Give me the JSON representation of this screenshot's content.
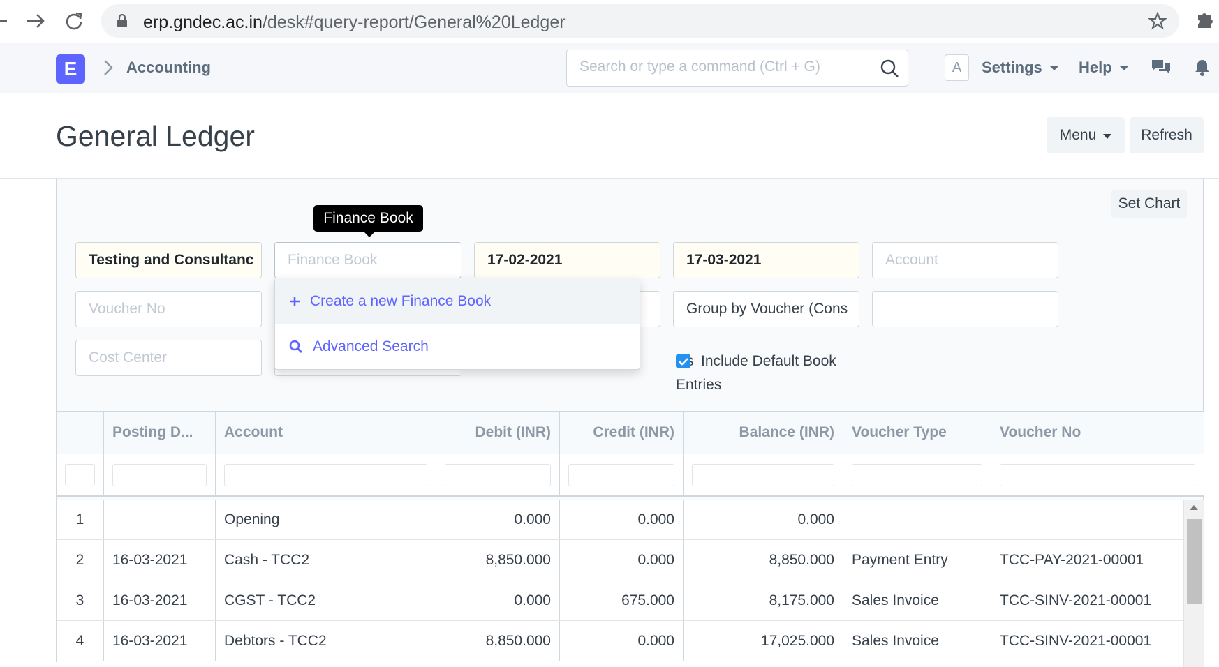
{
  "browser": {
    "url_host": "erp.gndec.ac.in",
    "url_path": "/desk#query-report/General%20Ledger"
  },
  "navbar": {
    "logo_letter": "E",
    "breadcrumb": "Accounting",
    "search_placeholder": "Search or type a command (Ctrl + G)",
    "avatar_letter": "A",
    "settings_label": "Settings",
    "help_label": "Help"
  },
  "page": {
    "title": "General Ledger",
    "menu_label": "Menu",
    "refresh_label": "Refresh"
  },
  "report": {
    "set_chart_label": "Set Chart",
    "filters": {
      "company_value": "Testing and Consultanc",
      "finance_book_placeholder": "Finance Book",
      "from_date_value": "17-02-2021",
      "to_date_value": "17-03-2021",
      "account_placeholder": "Account",
      "voucher_no_placeholder": "Voucher No",
      "group_by_value": "Group by Voucher (Cons",
      "cost_center_placeholder": "Cost Center",
      "partial_label": "s",
      "include_default_label_1": "Include Default Book",
      "include_default_label_2": "Entries"
    },
    "tooltip": "Finance Book",
    "dropdown": {
      "create_label": "Create a new Finance Book",
      "advanced_label": "Advanced Search"
    },
    "columns": [
      "",
      "Posting D...",
      "Account",
      "Debit (INR)",
      "Credit (INR)",
      "Balance (INR)",
      "Voucher Type",
      "Voucher No"
    ],
    "rows": [
      [
        "1",
        "",
        "Opening",
        "0.000",
        "0.000",
        "0.000",
        "",
        ""
      ],
      [
        "2",
        "16-03-2021",
        "Cash - TCC2",
        "8,850.000",
        "0.000",
        "8,850.000",
        "Payment Entry",
        "TCC-PAY-2021-00001"
      ],
      [
        "3",
        "16-03-2021",
        "CGST - TCC2",
        "0.000",
        "675.000",
        "8,175.000",
        "Sales Invoice",
        "TCC-SINV-2021-00001"
      ],
      [
        "4",
        "16-03-2021",
        "Debtors - TCC2",
        "8,850.000",
        "0.000",
        "17,025.000",
        "Sales Invoice",
        "TCC-SINV-2021-00001"
      ]
    ]
  },
  "colors": {
    "brand": "#5e64ff",
    "checkbox": "#2490ef",
    "filled_field_bg": "#fffdf4"
  }
}
